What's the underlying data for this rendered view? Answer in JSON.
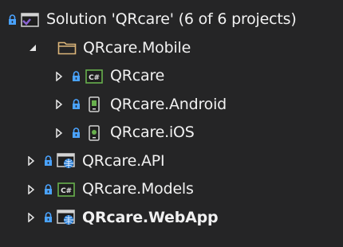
{
  "solution": {
    "label": "Solution 'QRcare' (6 of 6 projects)"
  },
  "items": [
    {
      "label": "QRcare.Mobile"
    },
    {
      "label": "QRcare"
    },
    {
      "label": "QRcare.Android"
    },
    {
      "label": "QRcare.iOS"
    },
    {
      "label": "QRcare.API"
    },
    {
      "label": "QRcare.Models"
    },
    {
      "label": "QRcare.WebApp"
    }
  ],
  "icons": {
    "csharp_text": "C#",
    "lock": "lock-icon",
    "expand": "chevron-right-icon",
    "collapse": "chevron-down-icon"
  },
  "colors": {
    "background": "#252526",
    "text": "#f1f1f1",
    "lock": "#4aa3ff",
    "folder": "#dcb67a",
    "csharp": "#68b04d",
    "web": "#2b7fd6",
    "solution_accent": "#8a63d2"
  }
}
